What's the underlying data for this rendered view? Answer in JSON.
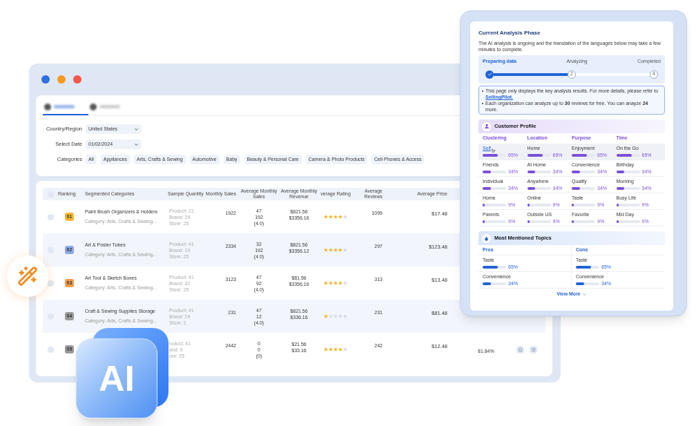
{
  "main_window": {
    "tabs": [
      {
        "selected": true
      },
      {
        "selected": false
      }
    ],
    "filters": [
      {
        "label": "Country/Region",
        "value": "United States"
      },
      {
        "label": "Select Date",
        "value": "01/02/2024"
      }
    ],
    "categories": {
      "label": "Categories",
      "items": [
        "All",
        "Appliances",
        "Arts, Crafts & Sewing",
        "Automotive",
        "Baby",
        "Beauty & Personal Care",
        "Camera & Photo Products",
        "Cell Phones & Access"
      ]
    },
    "table": {
      "columns": [
        "Ranking",
        "Segmented Categories",
        "Sample Quantity",
        "Monthly Sales",
        "Average Monthly Sales",
        "Average Monthly Revenue",
        "verage Rating",
        "Average Reviews",
        "Average Price"
      ],
      "select_all_checked": false,
      "rows": [
        {
          "checked": false,
          "rank": "01",
          "color": "#f5b82e",
          "name": "Paint Brush Organizers & Holders",
          "category": "Category: Arts, Crafts & Sewing...",
          "sample": [
            "Product: 21",
            "Brand: 29",
            "Store: 25"
          ],
          "monthly_sales": "1922",
          "avg_sales": [
            "47",
            "192",
            "(4.0)"
          ],
          "revenue": [
            "$821.56",
            "$3356.16"
          ],
          "stars": 4,
          "reviews": "1095",
          "price": "$17.48"
        },
        {
          "checked": false,
          "rank": "02",
          "color": "#8eaae6",
          "name": "Art & Poster Tubes",
          "category": "Category: Arts, Crafts & Sewing...",
          "sample": [
            "Product: 41",
            "Brand: 19",
            "Store: 25"
          ],
          "monthly_sales": "2334",
          "avg_sales": [
            "32",
            "192",
            "(4.0)"
          ],
          "revenue": [
            "$821.56",
            "$3356.12"
          ],
          "stars": 4,
          "reviews": "297",
          "price": "$123.48"
        },
        {
          "checked": false,
          "rank": "03",
          "color": "#f59a4a",
          "name": "Art Tool & Sketch Boxes",
          "category": "Category: Arts, Crafts & Sewing...",
          "sample": [
            "Product: 41",
            "Brand: 32",
            "Store: 25"
          ],
          "monthly_sales": "3123",
          "avg_sales": [
            "47",
            "92",
            "(4.0)"
          ],
          "revenue": [
            "$81.56",
            "$3356.16"
          ],
          "stars": 4,
          "reviews": "313",
          "price": "$13.48"
        },
        {
          "checked": false,
          "rank": "04",
          "color": "#9a9a9a",
          "name": "Craft & Sewing Supplies Storage",
          "category": "Category: Arts, Crafts & Sewing...",
          "sample": [
            "Product: 41",
            "Brand: 29",
            "Store: 2"
          ],
          "monthly_sales": "231",
          "avg_sales": [
            "47",
            "12",
            "(4.0)"
          ],
          "revenue": [
            "$821.56",
            "$336.16"
          ],
          "stars": 1,
          "reviews": "231",
          "price": "$81.48"
        },
        {
          "checked": false,
          "rank": "05",
          "color": "#9a9a9a",
          "sample": [
            "roduct: 41",
            "and: 9",
            "ore: 25"
          ],
          "monthly_sales": "2442",
          "avg_sales": [
            "0",
            "0",
            "(0)"
          ],
          "revenue": [
            "$21.56",
            "$33.16"
          ],
          "stars": 4,
          "reviews": "242",
          "price": "$12.48",
          "column_10": "81.84%",
          "show_actions": true
        }
      ]
    }
  },
  "analysis_panel": {
    "title": "Current Analysis Phase",
    "description": "The AI analysis is ongoing and the translation of the languages below may take a few minutes to complete.",
    "steps": [
      {
        "label": "Preparing data",
        "done": true
      },
      {
        "label": "Analyzing",
        "marker": "2",
        "done": false
      },
      {
        "label": "Completed",
        "marker": "4",
        "done": false
      }
    ],
    "progress": {
      "level": 0.5
    },
    "notes": [
      {
        "text": "This page only displays the key analysis results. For more details, please refer to ",
        "link": "SellingPilot."
      },
      {
        "text": "Each organization can analyze up to **30** reviews for free. You can anayze **24** more."
      }
    ],
    "customer_profile": {
      "title": "Customer Profile",
      "columns": [
        "Clustering",
        "Location",
        "Purpose",
        "Time"
      ],
      "rows": [
        {
          "selected": true,
          "cells": [
            {
              "kind": "link",
              "label": "Self",
              "level": 0.65,
              "reading": "65%"
            },
            {
              "kind": "text",
              "label": "Home",
              "level": 0.65,
              "reading": "65%"
            },
            {
              "kind": "text",
              "label": "Enjoyment",
              "level": 0.65,
              "reading": "65%"
            },
            {
              "kind": "text",
              "label": "On the Go",
              "level": 0.65,
              "reading": "65%"
            }
          ]
        },
        {
          "selected": false,
          "cells": [
            {
              "kind": "text",
              "label": "Friends",
              "level": 0.34,
              "reading": "34%"
            },
            {
              "kind": "text",
              "label": "At Home",
              "level": 0.34,
              "reading": "34%"
            },
            {
              "kind": "text",
              "label": "Convenience",
              "level": 0.34,
              "reading": "34%"
            },
            {
              "kind": "text",
              "label": "Birthday",
              "level": 0.34,
              "reading": "34%"
            }
          ]
        },
        {
          "selected": false,
          "cells": [
            {
              "kind": "text",
              "label": "Individual",
              "level": 0.34,
              "reading": "34%"
            },
            {
              "kind": "text",
              "label": "Anywhere",
              "level": 0.34,
              "reading": "34%"
            },
            {
              "kind": "text",
              "label": "Quality",
              "level": 0.34,
              "reading": "34%"
            },
            {
              "kind": "text",
              "label": "Morning",
              "level": 0.34,
              "reading": "34%"
            }
          ]
        },
        {
          "selected": false,
          "cells": [
            {
              "kind": "text",
              "label": "Home",
              "level": 0.09,
              "reading": "9%"
            },
            {
              "kind": "text",
              "label": "Online",
              "level": 0.09,
              "reading": "9%"
            },
            {
              "kind": "text",
              "label": "Taste",
              "level": 0.09,
              "reading": "9%"
            },
            {
              "kind": "text",
              "label": "Busy Life",
              "level": 0.09,
              "reading": "9%"
            }
          ]
        },
        {
          "selected": false,
          "cells": [
            {
              "kind": "text",
              "label": "Parents",
              "level": 0.09,
              "reading": "9%"
            },
            {
              "kind": "text",
              "label": "Outside US",
              "level": 0.09,
              "reading": "9%"
            },
            {
              "kind": "text",
              "label": "Favorite",
              "level": 0.09,
              "reading": "9%"
            },
            {
              "kind": "text",
              "label": "Mid Day",
              "level": 0.09,
              "reading": "9%"
            }
          ]
        }
      ]
    },
    "topics": {
      "title": "Most Mentioned Topics",
      "columns": [
        {
          "heading": "Pros",
          "items": [
            {
              "label": "Taste",
              "level": 0.65,
              "reading": "65%"
            },
            {
              "label": "Convenience",
              "level": 0.34,
              "reading": "34%"
            }
          ]
        },
        {
          "heading": "Cons",
          "items": [
            {
              "label": "Taste",
              "level": 0.65,
              "reading": "65%"
            },
            {
              "label": "Convenience",
              "level": 0.34,
              "reading": "34%"
            }
          ]
        }
      ]
    },
    "view_more": "View More"
  },
  "ai_badge": "AI"
}
